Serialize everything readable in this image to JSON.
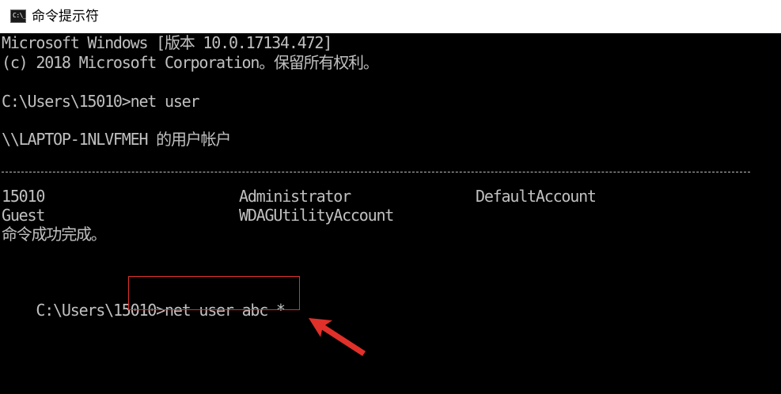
{
  "window": {
    "title": "命令提示符",
    "icon": "cmd-icon",
    "icon_text": "C:\\_"
  },
  "console": {
    "version_line": "Microsoft Windows [版本 10.0.17134.472]",
    "copyright_line": "(c) 2018 Microsoft Corporation。保留所有权利。",
    "command1": "C:\\Users\\15010>net user",
    "accounts_header": "\\\\LAPTOP-1NLVFMEH 的用户帐户",
    "accounts": [
      [
        "15010",
        "Administrator",
        "DefaultAccount"
      ],
      [
        "Guest",
        "WDAGUtilityAccount",
        ""
      ]
    ],
    "success_line": "命令成功完成。",
    "prompt2": "C:\\Users\\15010>",
    "command2": "net user abc *"
  },
  "colors": {
    "console_bg": "#000000",
    "console_text": "#c0c0c0",
    "annotation": "#e0302a"
  },
  "annotation": {
    "highlight": "command2",
    "arrow": "arrow-pointer-icon"
  }
}
